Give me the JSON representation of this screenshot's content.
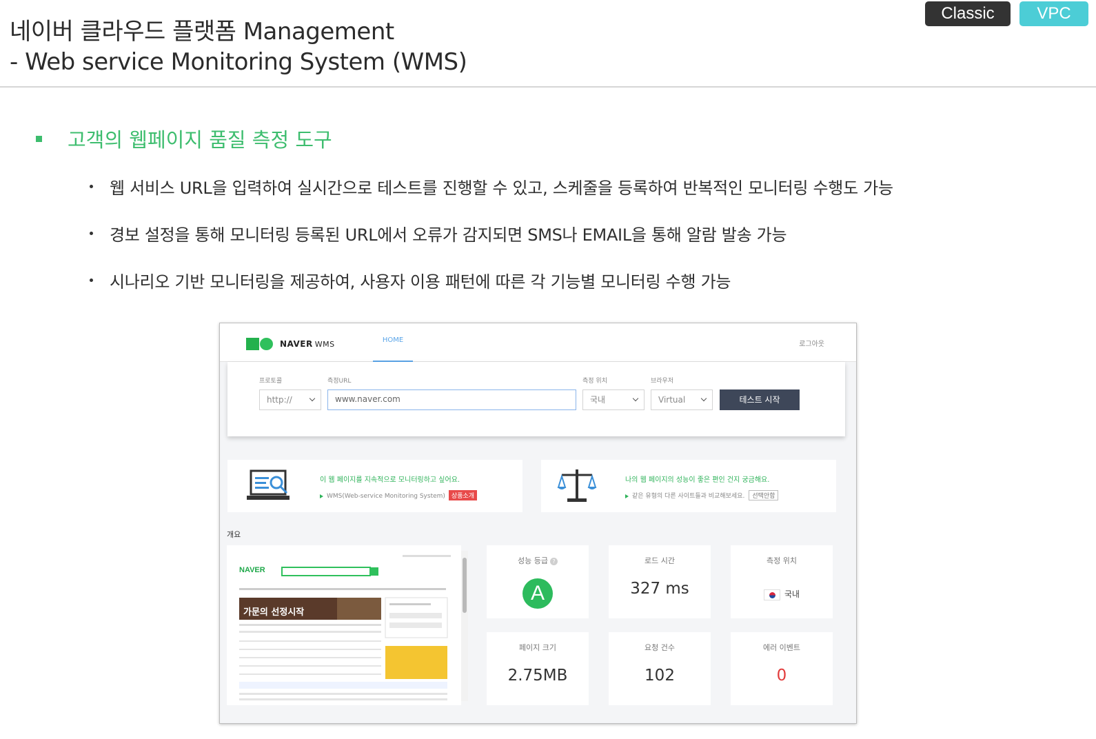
{
  "header": {
    "title_line1": "네이버 클라우드 플랫폼 Management",
    "title_line2": "- Web service Monitoring System (WMS)",
    "badges": [
      "Classic",
      "VPC"
    ]
  },
  "headline": "고객의 웹페이지 품질 측정 도구",
  "bullets": [
    "웹 서비스 URL을 입력하여 실시간으로 테스트를 진행할 수 있고, 스케줄을 등록하여 반복적인 모니터링 수행도 가능",
    "경보 설정을 통해 모니터링 등록된 URL에서 오류가 감지되면 SMS나 EMAIL을 통해 알람 발송 가능",
    "시나리오 기반 모니터링을 제공하여, 사용자 이용 패턴에 따른 각 기능별 모니터링 수행 가능"
  ],
  "wms": {
    "logo": "NAVER",
    "logo_suffix": "WMS",
    "nav_home": "HOME",
    "logout": "로그아웃",
    "form": {
      "protocol_label": "프로토콜",
      "protocol_value": "http://",
      "url_label": "측정URL",
      "url_value": "www.naver.com",
      "location_label": "측정 위치",
      "location_value": "국내",
      "browser_label": "브라우저",
      "browser_value": "Virtual",
      "start_button": "테스트 시작"
    },
    "promo_left": {
      "text": "이 웹 페이지를 지속적으로 모니터링하고 싶어요.",
      "sub": "WMS(Web-service Monitoring System)",
      "tag": "상품소개"
    },
    "promo_right": {
      "text": "나의 웹 페이지의 성능이 좋은 편인 건지 궁금해요.",
      "sub": "같은 유형의 다른 사이트들과 비교해보세요.",
      "tag": "선택안함"
    },
    "overview_label": "개요",
    "thumbnail": {
      "logo": "NAVER",
      "banner": "가문의 선정시작"
    },
    "metrics": {
      "grade_label": "성능 등급",
      "grade_value": "A",
      "load_label": "로드 시간",
      "load_value": "327 ms",
      "location_label": "측정 위치",
      "location_value": "국내",
      "size_label": "페이지 크기",
      "size_value": "2.75MB",
      "requests_label": "요청 건수",
      "requests_value": "102",
      "errors_label": "에러 이벤트",
      "errors_value": "0"
    },
    "colors": {
      "accent_green": "#3dbd6e",
      "grade_green": "#2dbb5d",
      "error_red": "#e23b3b",
      "button_dark": "#3e4759",
      "nav_blue": "#5aa5e8"
    }
  }
}
